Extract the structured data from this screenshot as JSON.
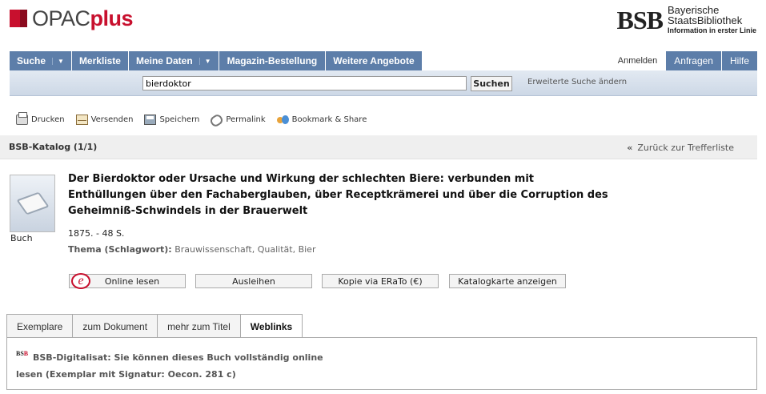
{
  "header": {
    "logo_main": "OPAC",
    "logo_plus": "plus",
    "bsb_mark": "BSB",
    "bsb_line1": "Bayerische",
    "bsb_line2": "StaatsBibliothek",
    "bsb_line3": "Information in erster Linie"
  },
  "nav": {
    "items": [
      {
        "label": "Suche"
      },
      {
        "label": "Merkliste"
      },
      {
        "label": "Meine Daten"
      },
      {
        "label": "Magazin-Bestellung"
      },
      {
        "label": "Weitere Angebote"
      }
    ],
    "login": "Anmelden",
    "inquiries": "Anfragen",
    "help": "Hilfe"
  },
  "search": {
    "value": "bierdoktor",
    "button": "Suchen",
    "advanced": "Erweiterte Suche ändern"
  },
  "toolbar": {
    "print": "Drucken",
    "send": "Versenden",
    "save": "Speichern",
    "permalink": "Permalink",
    "bookmark": "Bookmark & Share"
  },
  "catalog": {
    "title": "BSB-Katalog (1/1)",
    "back": "Zurück zur Trefferliste"
  },
  "record": {
    "media_type": "Buch",
    "title": "Der Bierdoktor oder Ursache und Wirkung der schlechten Biere: verbunden mit Enthüllungen über den Fachaberglauben, über Receptkrämerei und über die Corruption des Geheimniß-Schwindels in der Brauerwelt",
    "meta": "1875. - 48 S.",
    "subject_label": "Thema (Schlagwort):",
    "subjects": "Brauwissenschaft, Qualität, Bier"
  },
  "actions": {
    "online": "Online lesen",
    "borrow": "Ausleihen",
    "copy": "Kopie via ERaTo (€)",
    "card": "Katalogkarte anzeigen"
  },
  "tabs": {
    "copies": "Exemplare",
    "document": "zum Dokument",
    "more": "mehr zum Titel",
    "weblinks": "Weblinks"
  },
  "weblinks": {
    "text": "BSB-Digitalisat: Sie können dieses Buch vollständig online lesen (Exemplar mit Signatur: Oecon. 281 c)"
  },
  "colors": {
    "nav_blue": "#5d7ea9",
    "brand_red": "#c8102e"
  }
}
